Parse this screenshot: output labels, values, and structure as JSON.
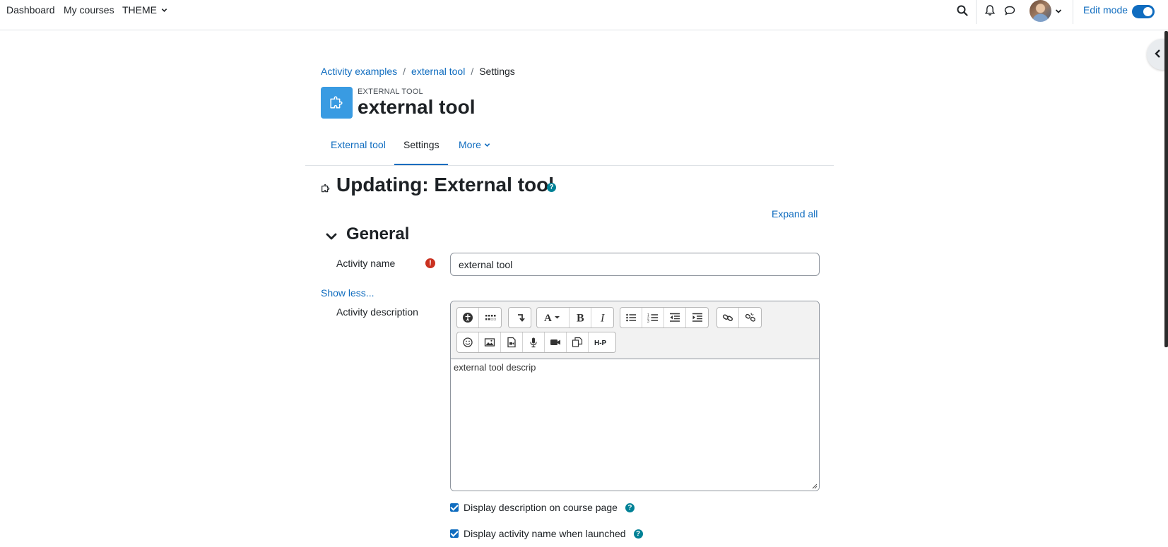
{
  "nav": {
    "dashboard": "Dashboard",
    "my_courses": "My courses",
    "theme": "THEME",
    "edit_mode": "Edit mode",
    "edit_mode_on": true
  },
  "breadcrumb": {
    "item1": "Activity examples",
    "item2": "external tool",
    "current": "Settings"
  },
  "activity": {
    "kind": "EXTERNAL TOOL",
    "title": "external tool"
  },
  "tabs": {
    "tab1": "External tool",
    "tab2": "Settings",
    "more": "More",
    "active": "Settings"
  },
  "heading": {
    "title": "Updating: External tool",
    "help": "?"
  },
  "form": {
    "expand_all": "Expand all",
    "section_general": "General",
    "activity_name_label": "Activity name",
    "activity_name_value": "external tool",
    "show_less": "Show less...",
    "activity_description_label": "Activity description",
    "description_text": "external tool descrip",
    "checkbox_display_description": "Display description on course page",
    "checkbox_display_name": "Display activity name when launched",
    "help": "?"
  },
  "colors": {
    "link": "#0f6cbf",
    "help": "#008196",
    "required": "#ca3120",
    "activity_icon": "#399be2"
  }
}
